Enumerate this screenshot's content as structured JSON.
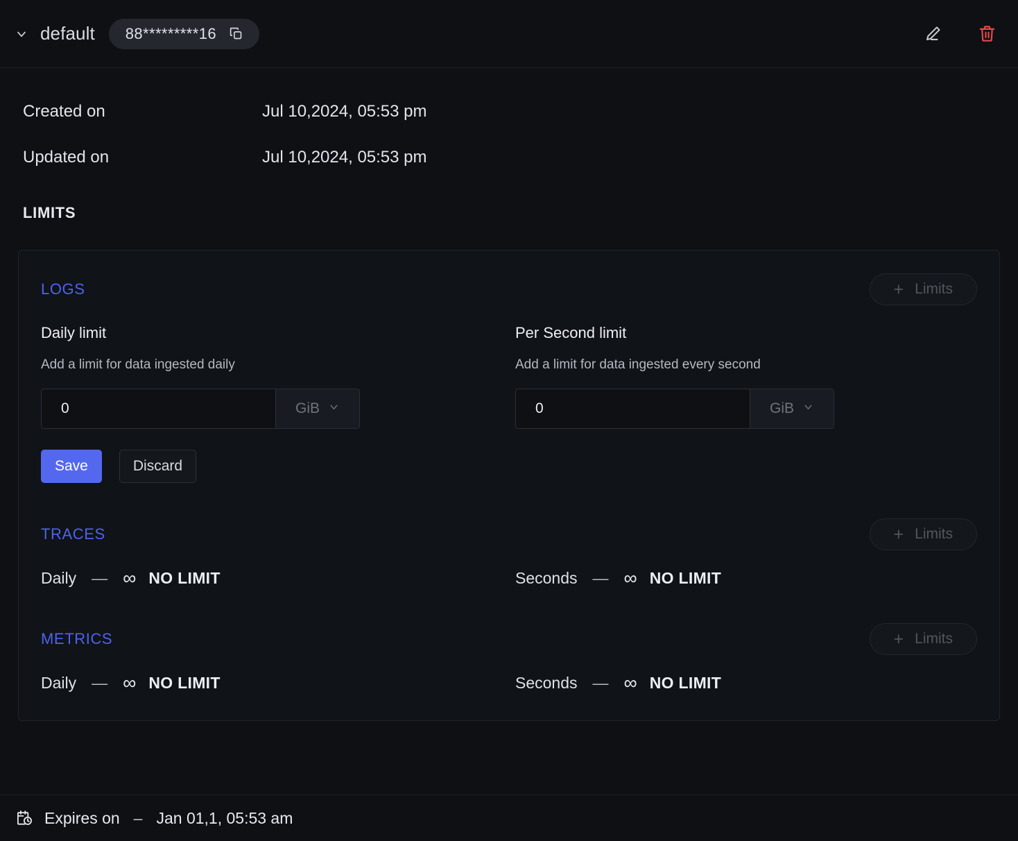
{
  "header": {
    "collapse_icon": "chevron-down-icon",
    "title": "default",
    "token": "88*********16",
    "copy_icon": "copy-icon",
    "edit_icon": "pencil-icon",
    "delete_icon": "trash-icon",
    "delete_color": "#e5484d"
  },
  "meta": [
    {
      "label": "Created on",
      "value": "Jul 10,2024, 05:53 pm"
    },
    {
      "label": "Updated on",
      "value": "Jul 10,2024, 05:53 pm"
    }
  ],
  "limits": {
    "section_title": "LIMITS",
    "accent_color": "#4d63f0",
    "add_button_label": "Limits",
    "add_button_plus": "+",
    "groups": [
      {
        "name": "LOGS",
        "kind": "editable",
        "fields": [
          {
            "title": "Daily limit",
            "description": "Add a limit for data ingested daily",
            "value": "0",
            "placeholder": "0",
            "unit": "GiB",
            "unit_chevron": "chevron-down-icon"
          },
          {
            "title": "Per Second limit",
            "description": "Add a limit for data ingested every second",
            "value": "0",
            "placeholder": "0",
            "unit": "GiB",
            "unit_chevron": "chevron-down-icon"
          }
        ],
        "save_label": "Save",
        "discard_label": "Discard",
        "save_color": "#5468ef"
      },
      {
        "name": "TRACES",
        "kind": "readonly",
        "rows": [
          {
            "label": "Daily",
            "dash": "—",
            "infinity": "∞",
            "value": "NO LIMIT"
          },
          {
            "label": "Seconds",
            "dash": "—",
            "infinity": "∞",
            "value": "NO LIMIT"
          }
        ]
      },
      {
        "name": "METRICS",
        "kind": "readonly",
        "rows": [
          {
            "label": "Daily",
            "dash": "—",
            "infinity": "∞",
            "value": "NO LIMIT"
          },
          {
            "label": "Seconds",
            "dash": "—",
            "infinity": "∞",
            "value": "NO LIMIT"
          }
        ]
      }
    ]
  },
  "footer": {
    "icon": "calendar-clock-icon",
    "label": "Expires on",
    "dash": "–",
    "value": "Jan 01,1, 05:53 am"
  }
}
